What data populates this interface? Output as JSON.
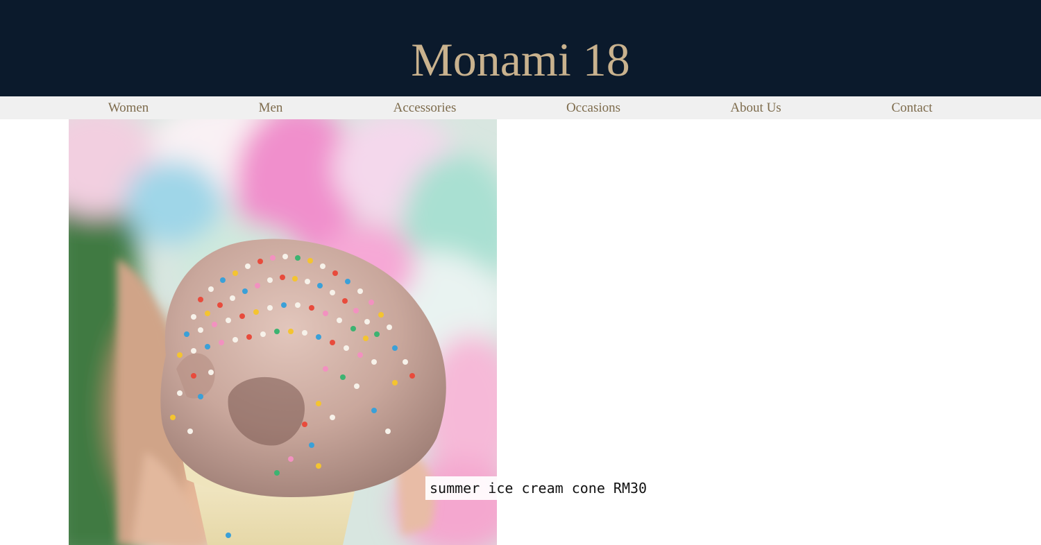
{
  "site": {
    "title": "Monami 18"
  },
  "nav": {
    "items": [
      "Women",
      "Men",
      "Accessories",
      "Occasions",
      "About Us",
      "Contact"
    ]
  },
  "product": {
    "image_subject": "ice cream cone with rainbow sprinkles",
    "caption": "summer ice cream cone RM30"
  },
  "colors": {
    "header_bg": "#0b1a2c",
    "title": "#c9b28e",
    "nav_bg": "#f0f0f0",
    "nav_text": "#7d6b4c"
  }
}
